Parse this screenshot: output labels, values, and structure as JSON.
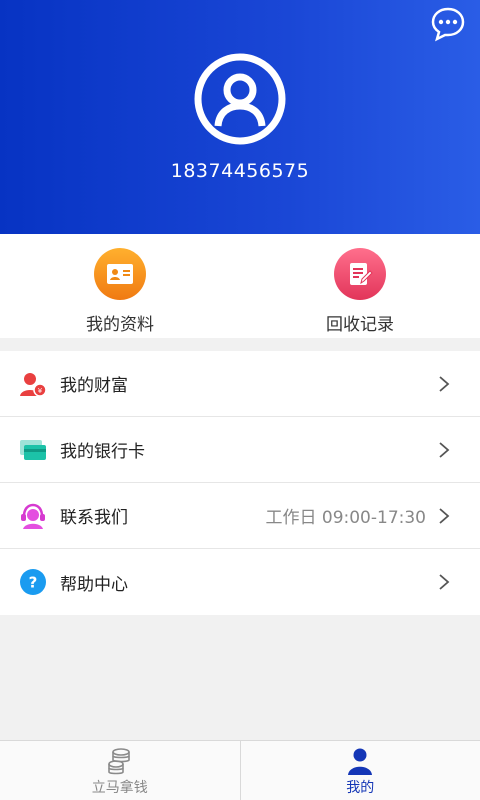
{
  "header": {
    "phone": "18374456575"
  },
  "quick": [
    {
      "label": "我的资料",
      "icon": "id-card-icon"
    },
    {
      "label": "回收记录",
      "icon": "edit-note-icon"
    }
  ],
  "menu": [
    {
      "label": "我的财富",
      "icon": "wealth-user-icon",
      "extra": ""
    },
    {
      "label": "我的银行卡",
      "icon": "bank-card-icon",
      "extra": ""
    },
    {
      "label": "联系我们",
      "icon": "customer-service-icon",
      "extra": "工作日 09:00-17:30"
    },
    {
      "label": "帮助中心",
      "icon": "help-icon",
      "extra": ""
    }
  ],
  "tabs": [
    {
      "label": "立马拿钱",
      "icon": "coins-icon",
      "active": false
    },
    {
      "label": "我的",
      "icon": "person-icon",
      "active": true
    }
  ],
  "colors": {
    "header_start": "#0733c3",
    "header_end": "#2a5de6",
    "active_tab": "#1436b6",
    "quick_profile": "#f5a623",
    "quick_record": "#ec4a6b"
  }
}
